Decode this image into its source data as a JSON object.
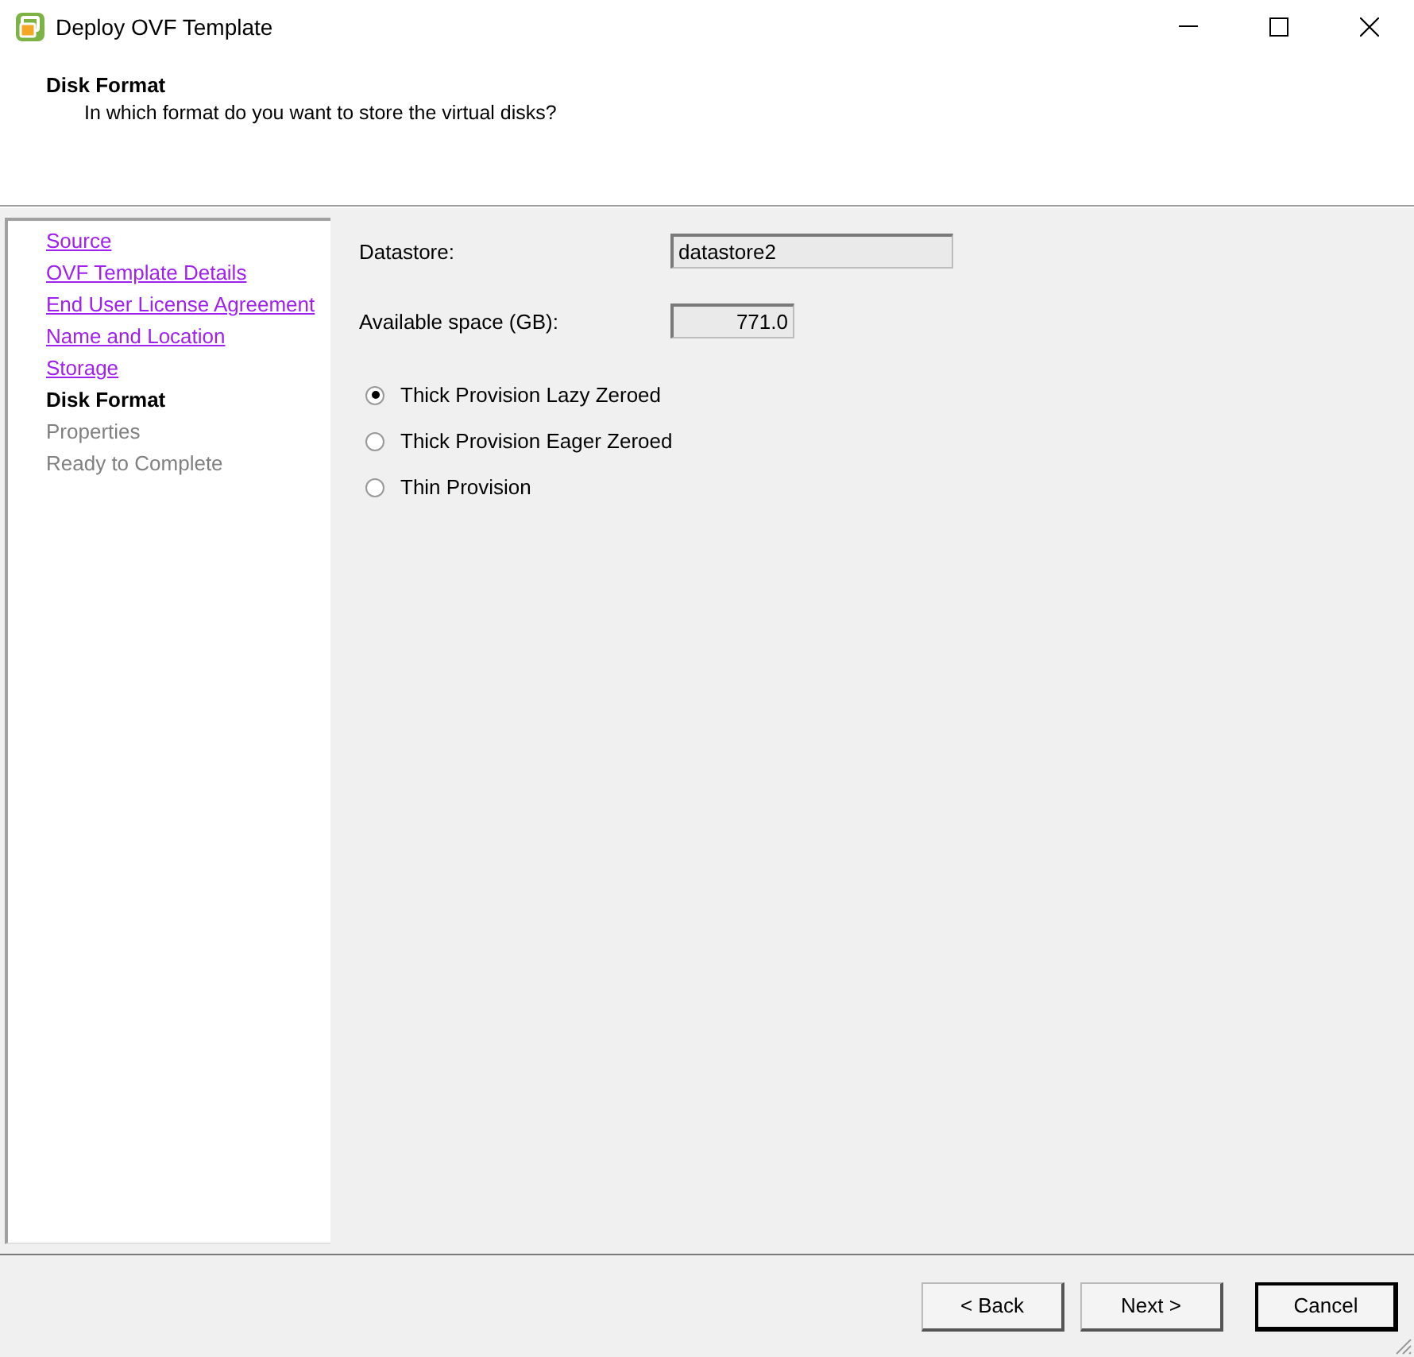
{
  "window": {
    "title": "Deploy OVF Template"
  },
  "header": {
    "title": "Disk Format",
    "subtitle": "In which format do you want to store the virtual disks?"
  },
  "steps": [
    {
      "label": "Source",
      "kind": "done"
    },
    {
      "label": "OVF Template Details",
      "kind": "done"
    },
    {
      "label": "End User License Agreement",
      "kind": "done"
    },
    {
      "label": "Name and Location",
      "kind": "done"
    },
    {
      "label": "Storage",
      "kind": "done"
    },
    {
      "label": "Disk Format",
      "kind": "current"
    },
    {
      "label": "Properties",
      "kind": "pending"
    },
    {
      "label": "Ready to Complete",
      "kind": "pending"
    }
  ],
  "fields": [
    {
      "label": "Datastore:",
      "value": "datastore2",
      "kind": "wide"
    },
    {
      "label": "Available space (GB):",
      "value": "771.0",
      "kind": "number"
    }
  ],
  "formats": [
    {
      "label": "Thick Provision Lazy Zeroed",
      "selected": true
    },
    {
      "label": "Thick Provision Eager Zeroed",
      "selected": false
    },
    {
      "label": "Thin Provision",
      "selected": false
    }
  ],
  "buttons": [
    {
      "label": "< Back",
      "kind": "normal"
    },
    {
      "label": "Next >",
      "kind": "normal"
    },
    {
      "label": "Cancel",
      "kind": "default"
    }
  ]
}
